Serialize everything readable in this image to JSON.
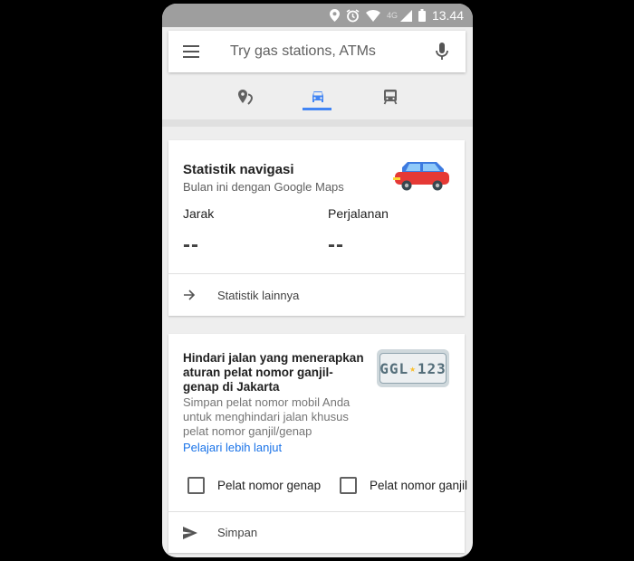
{
  "statusbar": {
    "network": "4G",
    "time": "13.44"
  },
  "search": {
    "placeholder": "Try gas stations, ATMs"
  },
  "modes": [
    "explore",
    "driving",
    "transit"
  ],
  "nav_stats": {
    "title": "Statistik navigasi",
    "subtitle": "Bulan ini dengan Google Maps",
    "distance_label": "Jarak",
    "distance_value": "--",
    "trips_label": "Perjalanan",
    "trips_value": "--",
    "more_label": "Statistik lainnya"
  },
  "odd_even": {
    "title": "Hindari jalan yang menerapkan aturan pelat nomor ganjil-genap di Jakarta",
    "description": "Simpan pelat nomor mobil Anda untuk menghindari jalan khusus pelat nomor ganjil/genap",
    "link": "Pelajari lebih lanjut",
    "plate_left": "GGL",
    "plate_right": "123",
    "option_even": "Pelat nomor genap",
    "option_odd": "Pelat nomor ganjil",
    "save_label": "Simpan",
    "option_even_checked": false,
    "option_odd_checked": false
  },
  "colors": {
    "accent": "#4285f4",
    "link": "#1a73e8",
    "car": "#e53935",
    "car_top": "#3d7be0"
  }
}
